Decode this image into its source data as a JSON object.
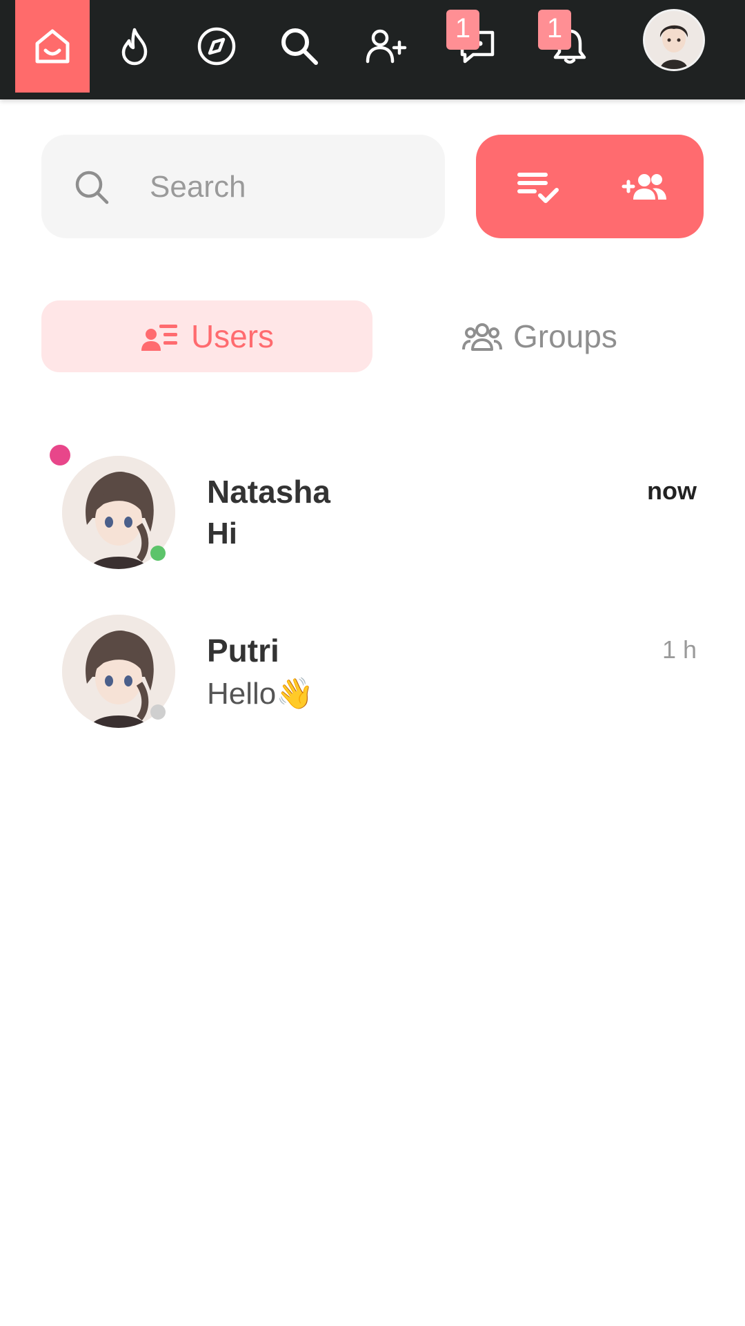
{
  "nav": {
    "items": [
      {
        "name": "home",
        "active": true
      },
      {
        "name": "hot"
      },
      {
        "name": "explore"
      },
      {
        "name": "search"
      },
      {
        "name": "add-friend"
      },
      {
        "name": "messages",
        "badge": "1"
      },
      {
        "name": "notifications",
        "badge": "1"
      }
    ]
  },
  "search": {
    "placeholder": "Search",
    "value": ""
  },
  "tabs": {
    "users": "Users",
    "groups": "Groups"
  },
  "chats": [
    {
      "name": "Natasha",
      "message": "Hi",
      "time": "now",
      "unread": true,
      "online": true
    },
    {
      "name": "Putri",
      "message": "Hello👋",
      "time": "1 h",
      "unread": false,
      "online": false
    }
  ],
  "colors": {
    "accent": "#ff6b6f",
    "topbar": "#1f2222",
    "tab_active_bg": "#ffe6e7",
    "badge": "#ff8f94",
    "online": "#5cc46a",
    "offline": "#cfcfcf",
    "unread_dot": "#e8468a"
  }
}
